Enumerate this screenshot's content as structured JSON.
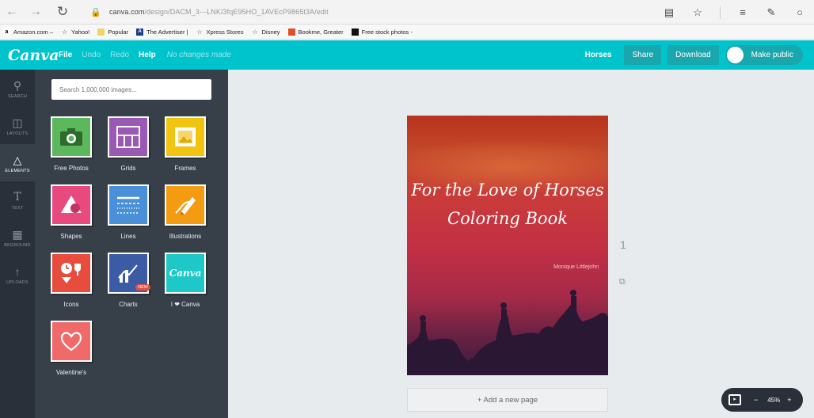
{
  "browser": {
    "url_host": "canva.com",
    "url_path": "/design/DACM_3---LNK/3fqE95HO_1AVEcP9865t3A/edit",
    "bookmarks": [
      {
        "label": "Amazon.com –",
        "icon": "amazon-icon"
      },
      {
        "label": "Yahoo!",
        "icon": "star-icon"
      },
      {
        "label": "Popular",
        "icon": "folder-icon"
      },
      {
        "label": "The Advertiser |",
        "icon": "advertiser-icon"
      },
      {
        "label": "Xpress Stores",
        "icon": "star-icon"
      },
      {
        "label": "Disney",
        "icon": "star-icon"
      },
      {
        "label": "Bookme, Greater",
        "icon": "bookme-icon"
      },
      {
        "label": "Free stock photos -",
        "icon": "free-stock-icon"
      }
    ]
  },
  "header": {
    "logo": "Canva",
    "menu": {
      "file": "File",
      "undo": "Undo",
      "redo": "Redo",
      "help": "Help"
    },
    "status": "No changes made",
    "doc_title": "Horses",
    "share": "Share",
    "download": "Download",
    "make_public": "Make public",
    "accent": "#00c4cc"
  },
  "rail": {
    "items": [
      {
        "label": "SEARCH",
        "icon": "search-icon"
      },
      {
        "label": "LAYOUTS",
        "icon": "layouts-icon"
      },
      {
        "label": "ELEMENTS",
        "icon": "elements-icon"
      },
      {
        "label": "TEXT",
        "icon": "text-icon"
      },
      {
        "label": "BKGROUND",
        "icon": "background-icon"
      },
      {
        "label": "UPLOADS",
        "icon": "uploads-icon"
      }
    ]
  },
  "panel": {
    "search_placeholder": "Search 1,000,000 images...",
    "tiles": [
      {
        "label": "Free Photos",
        "color": "#5cb85c",
        "icon": "camera-icon"
      },
      {
        "label": "Grids",
        "color": "#9b59b6",
        "icon": "grid-icon"
      },
      {
        "label": "Frames",
        "color": "#f1c40f",
        "icon": "frame-icon"
      },
      {
        "label": "Shapes",
        "color": "#e84a7f",
        "icon": "shapes-icon"
      },
      {
        "label": "Lines",
        "color": "#4a90d9",
        "icon": "lines-icon"
      },
      {
        "label": "Illustrations",
        "color": "#f39c12",
        "icon": "pencil-icon"
      },
      {
        "label": "Icons",
        "color": "#e74c3c",
        "icon": "icons-icon"
      },
      {
        "label": "Charts",
        "color": "#3b5ba5",
        "icon": "chart-icon",
        "badge": "NEW"
      },
      {
        "label": "I ❤ Canva",
        "color": "#1ec8c8",
        "icon": "canva-logo-icon",
        "tile_text": "Canva"
      },
      {
        "label": "Valentine's",
        "color": "#f06a6a",
        "icon": "heart-icon"
      }
    ]
  },
  "canvas": {
    "title_line1": "For the Love of Horses",
    "title_line2": "Coloring Book",
    "author": "Monique Littlejohn",
    "page_number": "1",
    "add_page": "+ Add a new page",
    "zoom": "45%"
  }
}
